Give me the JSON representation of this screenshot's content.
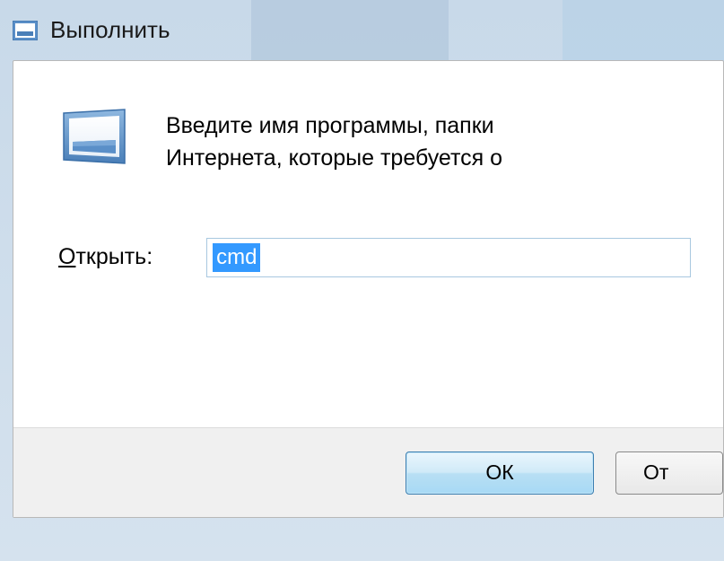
{
  "titlebar": {
    "title": "Выполнить"
  },
  "content": {
    "description_line1": "Введите имя программы, папки",
    "description_line2": "Интернета, которые требуется о",
    "open_label_underlined": "О",
    "open_label_rest": "ткрыть:",
    "input_value": "cmd"
  },
  "buttons": {
    "ok": "ОК",
    "cancel": "От"
  }
}
